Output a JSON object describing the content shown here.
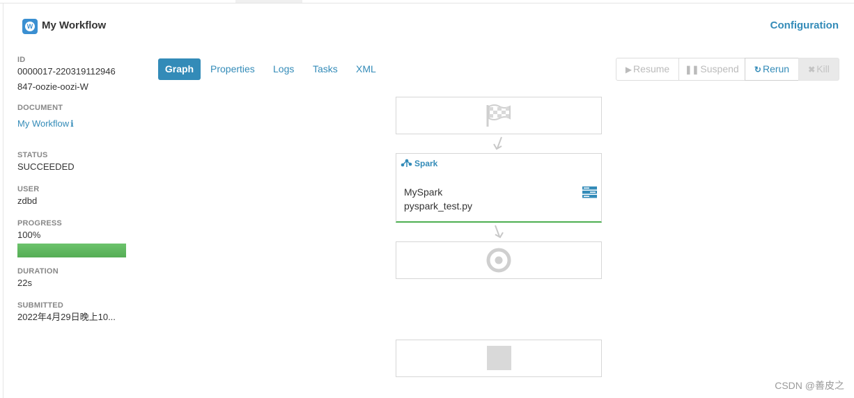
{
  "header": {
    "logo_letter": "W",
    "title": "My Workflow",
    "config_label": "Configuration"
  },
  "meta": {
    "id_label": "ID",
    "id_line1": "0000017-220319112946",
    "id_line2": "847-oozie-oozi-W",
    "document_label": "DOCUMENT",
    "document_value": "My Workflow",
    "info_glyph": "i",
    "status_label": "STATUS",
    "status_value": "SUCCEEDED",
    "user_label": "USER",
    "user_value": "zdbd",
    "progress_label": "PROGRESS",
    "progress_text": "100%",
    "progress_percent": 100,
    "duration_label": "DURATION",
    "duration_value": "22s",
    "submitted_label": "SUBMITTED",
    "submitted_value": "2022年4月29日晚上10..."
  },
  "tabs": [
    {
      "label": "Graph",
      "active": true
    },
    {
      "label": "Properties",
      "active": false
    },
    {
      "label": "Logs",
      "active": false
    },
    {
      "label": "Tasks",
      "active": false
    },
    {
      "label": "XML",
      "active": false
    }
  ],
  "actions": {
    "resume": "Resume",
    "suspend": "Suspend",
    "rerun": "Rerun",
    "kill": "Kill"
  },
  "graph": {
    "start_icon": "flag-checkered-icon",
    "spark": {
      "type_label": "Spark",
      "name": "MySpark",
      "file": "pyspark_test.py",
      "status_color": "#4caf50"
    },
    "end_icon": "bullseye-icon",
    "kill_icon": "square-icon"
  },
  "colors": {
    "accent": "#338bb8",
    "success": "#5cb85c"
  },
  "watermark": "CSDN @善皮之"
}
